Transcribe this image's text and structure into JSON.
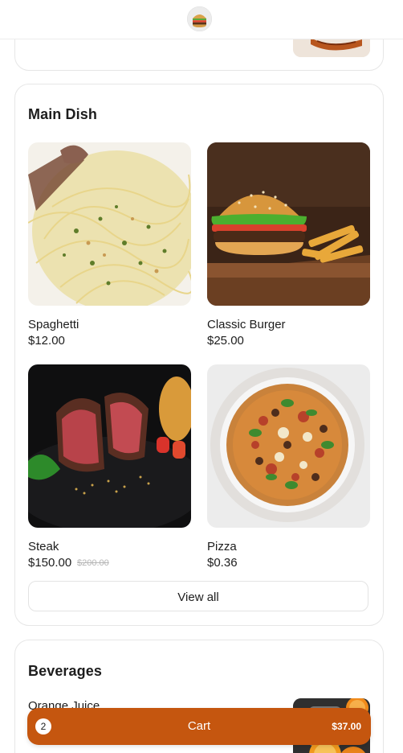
{
  "colors": {
    "accent": "#c5560f",
    "card_border": "#e6e6e6",
    "text": "#1d1d1d",
    "muted_strike": "#b5b5b5"
  },
  "header": {
    "logo_icon": "burger-logo-icon"
  },
  "sections": {
    "main": {
      "title": "Main Dish",
      "items": [
        {
          "name": "Spaghetti",
          "price": "$12.00",
          "image": "spaghetti-photo"
        },
        {
          "name": "Classic Burger",
          "price": "$25.00",
          "image": "burger-photo"
        },
        {
          "name": "Steak",
          "price": "$150.00",
          "old_price": "$200.00",
          "image": "steak-photo"
        },
        {
          "name": "Pizza",
          "price": "$0.36",
          "image": "pizza-photo"
        }
      ],
      "view_all_label": "View all"
    },
    "beverages": {
      "title": "Beverages",
      "items": [
        {
          "name": "Orange Juice",
          "image": "orange-juice-photo"
        }
      ]
    }
  },
  "cart": {
    "count": "2",
    "label": "Cart",
    "total": "$37.00"
  }
}
